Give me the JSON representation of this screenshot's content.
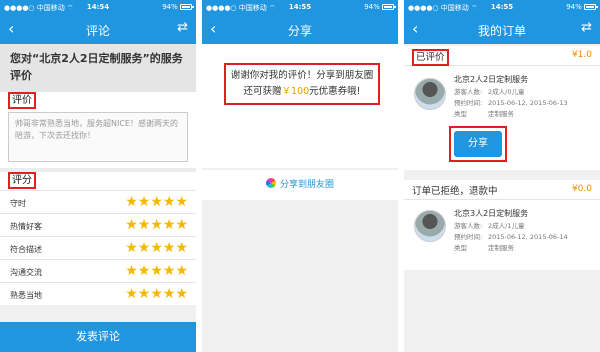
{
  "status_bar": {
    "carrier": "●●●●○ 中国移动 ⌔",
    "time_1": "14:54",
    "time_2": "14:55",
    "time_3": "14:55",
    "battery": "94%"
  },
  "screen1": {
    "nav_title": "评论",
    "product_title": "您对“北京2人2日定制服务”的服务评价",
    "comment_label": "评价",
    "comment_text": "帅哥非常熟悉当地，服务超NICE！感谢两天的陪游，下次去还找你！",
    "rating_label": "评分",
    "ratings": [
      {
        "label": "守时",
        "stars": "★★★★★",
        "value": 5
      },
      {
        "label": "热情好客",
        "stars": "★★★★★",
        "value": 5
      },
      {
        "label": "符合描述",
        "stars": "★★★★★",
        "value": 5
      },
      {
        "label": "沟通交流",
        "stars": "★★★★★",
        "value": 5
      },
      {
        "label": "熟悉当地",
        "stars": "★★★★★",
        "value": 5
      }
    ],
    "submit_label": "发表评论"
  },
  "screen2": {
    "nav_title": "分享",
    "message_line1": "谢谢你对我的评价！分享到朋友圈",
    "message_line2_prefix": "还可获赠",
    "message_amount": "￥100",
    "message_line2_suffix": "元优惠券哦!",
    "share_link_label": "分享到朋友圈"
  },
  "screen3": {
    "nav_title": "我的订单",
    "orders": [
      {
        "status": "已评价",
        "price": "¥1.0",
        "name": "北京2人2日定制服务",
        "visitors_key": "游客人数:",
        "visitors_val": "2成人/0儿童",
        "date_key": "预约时间:",
        "date_val": "2015-06-12, 2015-06-13",
        "type_key": "类型",
        "type_val": "定制服务",
        "share_label": "分享"
      },
      {
        "status": "订单已拒绝，退款中",
        "price": "¥0.0",
        "name": "北京3人2日定制服务",
        "visitors_key": "游客人数:",
        "visitors_val": "2成人/1儿童",
        "date_key": "预约时间:",
        "date_val": "2015-06-12, 2015-06-14",
        "type_key": "类型",
        "type_val": "定制服务"
      }
    ]
  },
  "icons": {
    "back": "‹",
    "refresh": "⇄"
  },
  "colors": {
    "brand_blue": "#2196e0",
    "highlight_red": "#e02020",
    "star_gold": "#f5b800",
    "price_orange": "#e89000"
  }
}
